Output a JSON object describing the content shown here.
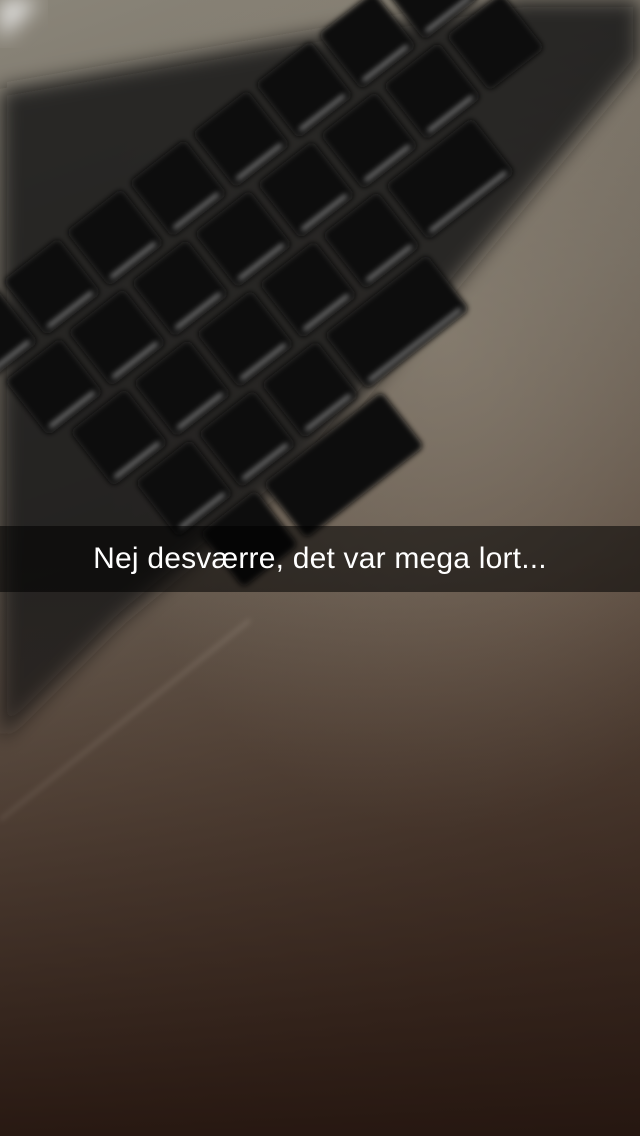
{
  "snap": {
    "caption": "Nej desværre, det var mega lort..."
  },
  "colors": {
    "caption_bar": "#000000",
    "caption_text": "#ffffff",
    "keycap": "#0e0e10",
    "key_highlight": "#d8d8d8",
    "body_top": "#8a8579",
    "body_bottom": "#2e1f18"
  }
}
